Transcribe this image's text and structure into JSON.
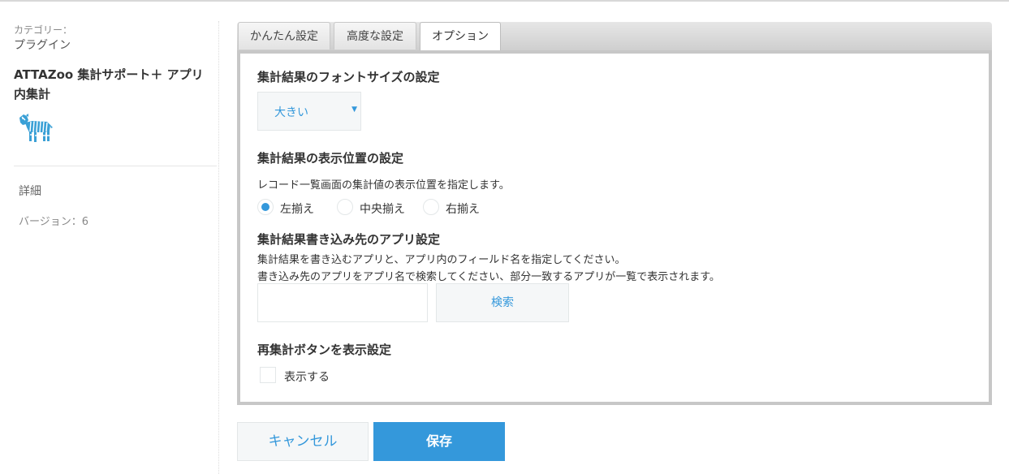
{
  "sidebar": {
    "category_label": "カテゴリー：",
    "category_value": "プラグイン",
    "plugin_name": "ATTAZoo 集計サポート＋ アプリ内集計",
    "logo_icon": "zebra-icon",
    "detail_link": "詳細",
    "version": "バージョン：6"
  },
  "tabs": [
    {
      "label": "かんたん設定",
      "active": false
    },
    {
      "label": "高度な設定",
      "active": false
    },
    {
      "label": "オプション",
      "active": true
    }
  ],
  "font_size_section": {
    "heading": "集計結果のフォントサイズの設定",
    "selected": "大きい"
  },
  "position_section": {
    "heading": "集計結果の表示位置の設定",
    "description": "レコード一覧画面の集計値の表示位置を指定します。",
    "options": [
      {
        "label": "左揃え",
        "checked": true
      },
      {
        "label": "中央揃え",
        "checked": false
      },
      {
        "label": "右揃え",
        "checked": false
      }
    ]
  },
  "target_app_section": {
    "heading": "集計結果書き込み先のアプリ設定",
    "line1": "集計結果を書き込むアプリと、アプリ内のフィールド名を指定してください。",
    "line2": "書き込み先のアプリをアプリ名で検索してください、部分一致するアプリが一覧で表示されます。",
    "input_value": "",
    "search_label": "検索"
  },
  "recalc_section": {
    "heading": "再集計ボタンを表示設定",
    "checkbox_label": "表示する",
    "checked": false
  },
  "actions": {
    "cancel_label": "キャンセル",
    "save_label": "保存"
  },
  "colors": {
    "accent": "#3498db",
    "panel_border": "#c7c7c7",
    "field_bg": "#f5f7f8"
  }
}
